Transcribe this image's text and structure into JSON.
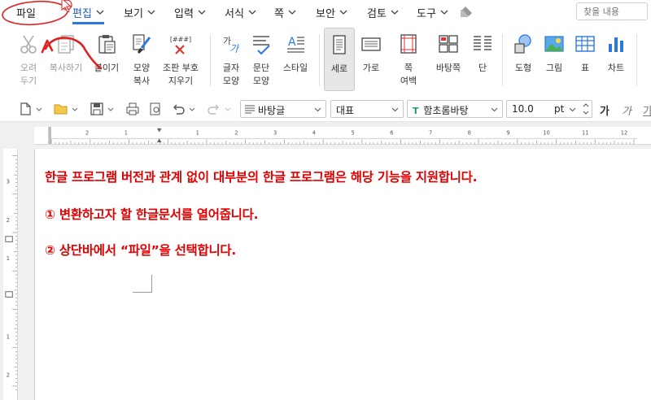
{
  "menubar": {
    "items": [
      {
        "label": "파일",
        "has_dropdown": false
      },
      {
        "label": "편집",
        "has_dropdown": true,
        "active": true
      },
      {
        "label": "보기",
        "has_dropdown": true
      },
      {
        "label": "입력",
        "has_dropdown": true
      },
      {
        "label": "서식",
        "has_dropdown": true
      },
      {
        "label": "쪽",
        "has_dropdown": true
      },
      {
        "label": "보안",
        "has_dropdown": true
      },
      {
        "label": "검토",
        "has_dropdown": true
      },
      {
        "label": "도구",
        "has_dropdown": true
      }
    ],
    "search_placeholder": "찾을 내용"
  },
  "ribbon": {
    "buttons": [
      {
        "label": "오려\n두기",
        "icon": "scissors-icon",
        "disabled": true
      },
      {
        "label": "복사하기",
        "icon": "copy-icon",
        "disabled": true
      },
      {
        "label": "붙이기",
        "icon": "paste-icon"
      },
      {
        "label": "모양\n복사",
        "icon": "format-painter-icon"
      },
      {
        "label": "조판 부호\n지우기",
        "icon": "clear-codes-icon"
      },
      {
        "label": "글자\n모양",
        "icon": "char-shape-icon"
      },
      {
        "label": "문단\n모양",
        "icon": "para-shape-icon"
      },
      {
        "label": "스타일",
        "icon": "style-icon"
      },
      {
        "label": "세로",
        "icon": "portrait-icon",
        "selected": true
      },
      {
        "label": "가로",
        "icon": "landscape-icon"
      },
      {
        "label": "쪽\n여백",
        "icon": "page-margin-icon"
      },
      {
        "label": "바탕쪽",
        "icon": "master-page-icon"
      },
      {
        "label": "단",
        "icon": "columns-icon"
      },
      {
        "label": "도형",
        "icon": "shape-icon"
      },
      {
        "label": "그림",
        "icon": "picture-icon"
      },
      {
        "label": "표",
        "icon": "table-icon"
      },
      {
        "label": "차트",
        "icon": "chart-icon"
      }
    ],
    "clear_codes_glyph": "[###]"
  },
  "toolbar": {
    "style_value": "바탕글",
    "lang_value": "대표",
    "font_value": "함초롬바탕",
    "size_value": "10.0",
    "size_unit": "pt",
    "bold_glyph": "가",
    "italic_glyph": "가",
    "underline_glyph": "가"
  },
  "document": {
    "lines": [
      "한글 프로그램 버전과 관계 없이 대부분의 한글 프로그램은 해당 기능을 지원합니다.",
      "① 변환하고자 할 한글문서를 열어줍니다.",
      "② 상단바에서 “파일”을 선택합니다."
    ],
    "text_color": "#e30000"
  },
  "annotation": {
    "color": "#e02020"
  },
  "colors": {
    "accent": "#2b78e4",
    "active_menu_text": "#1e5fb7"
  }
}
